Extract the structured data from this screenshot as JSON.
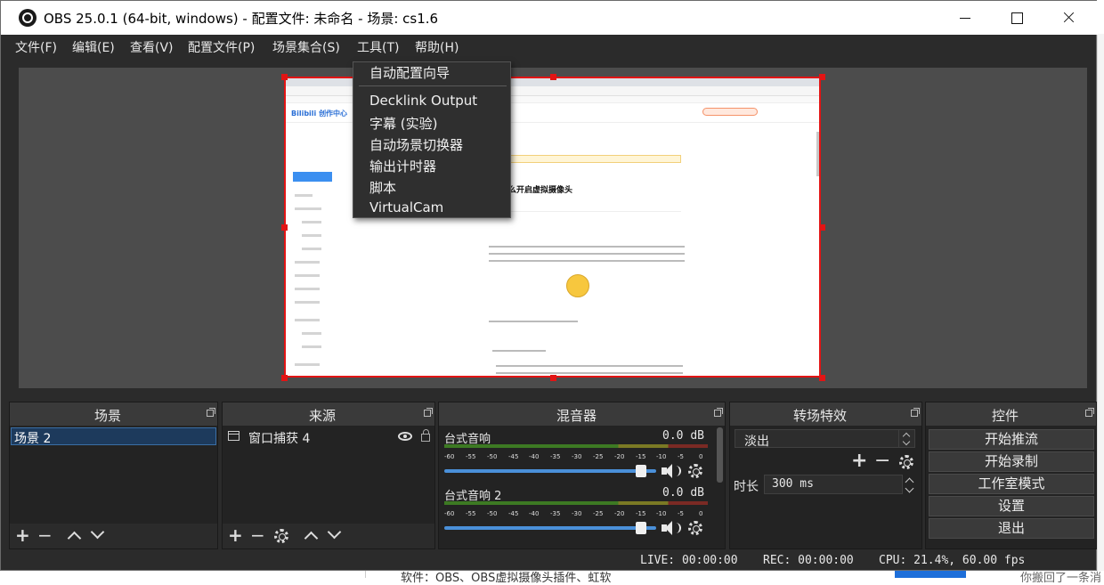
{
  "window": {
    "title": "OBS 25.0.1 (64-bit, windows) - 配置文件: 未命名 - 场景: cs1.6"
  },
  "menu": {
    "items": [
      {
        "label": "文件(F)"
      },
      {
        "label": "编辑(E)"
      },
      {
        "label": "查看(V)"
      },
      {
        "label": "配置文件(P)"
      },
      {
        "label": "场景集合(S)"
      },
      {
        "label": "工具(T)"
      },
      {
        "label": "帮助(H)"
      }
    ]
  },
  "tools_menu": {
    "items": [
      {
        "label": "自动配置向导"
      },
      {
        "label": "Decklink Output"
      },
      {
        "label": "字幕 (实验)"
      },
      {
        "label": "自动场景切换器"
      },
      {
        "label": "输出计时器"
      },
      {
        "label": "脚本"
      },
      {
        "label": "VirtualCam"
      }
    ]
  },
  "preview": {
    "heading": "么开启虚拟摄像头",
    "logo": "Bilibili 创作中心"
  },
  "docks": {
    "scenes": {
      "title": "场景",
      "items": [
        {
          "label": "场景 2"
        }
      ]
    },
    "sources": {
      "title": "来源",
      "items": [
        {
          "label": "窗口捕获 4"
        }
      ]
    },
    "mixer": {
      "title": "混音器",
      "channels": [
        {
          "name": "台式音响",
          "db": "0.0 dB",
          "volume_fraction": 0.93
        },
        {
          "name": "台式音响 2",
          "db": "0.0 dB",
          "volume_fraction": 0.93
        }
      ],
      "ticks": [
        "-60",
        "-55",
        "-50",
        "-45",
        "-40",
        "-35",
        "-30",
        "-25",
        "-20",
        "-15",
        "-10",
        "-5",
        "0"
      ]
    },
    "transitions": {
      "title": "转场特效",
      "selected": "淡出",
      "duration_label": "时长",
      "duration_value": "300 ms"
    },
    "controls": {
      "title": "控件",
      "buttons": [
        {
          "label": "开始推流"
        },
        {
          "label": "开始录制"
        },
        {
          "label": "工作室模式"
        },
        {
          "label": "设置"
        },
        {
          "label": "退出"
        }
      ]
    }
  },
  "status": {
    "live": "LIVE: 00:00:00",
    "rec": "REC: 00:00:00",
    "cpu": "CPU: 21.4%, 60.00 fps"
  },
  "background": {
    "bottom_text": "软件：OBS、OBS虚拟摄像头插件、虹软",
    "bottom_right_text": "你搬回了一条消"
  },
  "colors": {
    "accent_red": "#e21414",
    "selection_blue": "#1d3a5c",
    "volume_blue": "#4a90d9",
    "meter_green": "#3d7a23",
    "meter_yellow": "#7b7a24",
    "meter_red": "#7b2a24"
  }
}
